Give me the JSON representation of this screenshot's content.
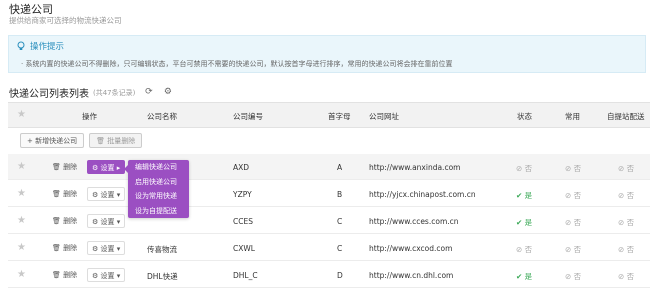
{
  "header": {
    "title": "快递公司",
    "subtitle": "提供给商家可选择的物流快递公司"
  },
  "tip": {
    "title": "操作提示",
    "text": "系统内置的快递公司不得删除，只可编辑状态，平台可禁用不需要的快递公司，默认按首字母进行排序，常用的快递公司将会排在靠前位置"
  },
  "list": {
    "title": "快递公司列表列表",
    "count": "(共47条记录)"
  },
  "table": {
    "columns": [
      "操作",
      "公司名称",
      "公司编号",
      "首字母",
      "公司网址",
      "状态",
      "常用",
      "自提站配送"
    ],
    "add_label": "新增快递公司",
    "batch_delete_label": "批量删除",
    "delete_label": "删除",
    "settings_label": "设置",
    "rows": [
      {
        "name": "",
        "code": "AXD",
        "letter": "A",
        "url": "http://www.anxinda.com",
        "status": "否",
        "common": "否",
        "pickup": "否"
      },
      {
        "name": "",
        "code": "YZPY",
        "letter": "B",
        "url": "http://yjcx.chinapost.com.cn",
        "status": "是",
        "common": "否",
        "pickup": "否"
      },
      {
        "name": "",
        "code": "CCES",
        "letter": "C",
        "url": "http://www.cces.com.cn",
        "status": "是",
        "common": "否",
        "pickup": "否"
      },
      {
        "name": "传喜物流",
        "code": "CXWL",
        "letter": "C",
        "url": "http://www.cxcod.com",
        "status": "否",
        "common": "否",
        "pickup": "否"
      },
      {
        "name": "DHL快递",
        "code": "DHL_C",
        "letter": "D",
        "url": "http://www.cn.dhl.com",
        "status": "是",
        "common": "否",
        "pickup": "否"
      }
    ]
  },
  "dropdown": {
    "items": [
      "编辑快递公司",
      "启用快递公司",
      "设为常用快递",
      "设为自提配送"
    ]
  },
  "colors": {
    "accent": "#9b4fc2",
    "tip_bg": "#eaf6fb",
    "tip_text": "#2a8fbd",
    "yes": "#3aa856",
    "no": "#aaaaaa"
  }
}
